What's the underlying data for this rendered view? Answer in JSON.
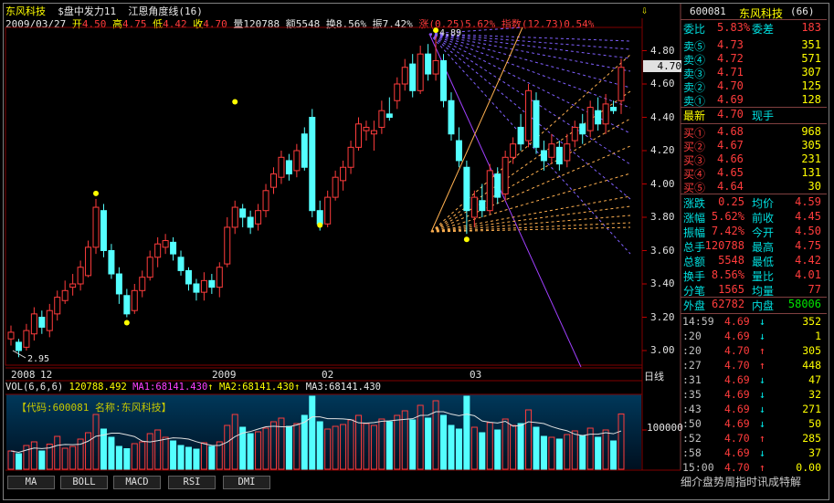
{
  "header": {
    "stock_name": "东风科技",
    "indicator": "$盘中发力11",
    "line_name": "江恩角度线(16)",
    "date": "2009/03/27",
    "open_label": "开",
    "open": "4.50",
    "high_label": "高",
    "high": "4.75",
    "low_label": "低",
    "low": "4.42",
    "close_label": "收",
    "close": "4.70",
    "vol_label": "量",
    "vol": "120788",
    "amt_label": "额",
    "amt": "5548",
    "turn_label": "换",
    "turn": "8.56%",
    "amp_label": "振",
    "amp": "7.42%",
    "chg_label": "涨",
    "chg": "(0.25)5.62%",
    "index_label": "指数",
    "index": "(12.73)0.54%",
    "flag_icon": "⇩"
  },
  "price_axis": [
    "4.80",
    "4.60",
    "4.40",
    "4.20",
    "4.00",
    "3.80",
    "3.60",
    "3.40",
    "3.20",
    "3.00"
  ],
  "current_price_tag": "4.70",
  "annotations": {
    "high_mark": "4.89",
    "low_mark": "2.95"
  },
  "time_axis": [
    "2008",
    "12",
    "2009",
    "02",
    "03"
  ],
  "period_label": "日线",
  "volume": {
    "header_name": "VOL(6,6,6)",
    "value": "120788.492",
    "ma1": "MA1:68141.430",
    "ma2": "MA2:68141.430",
    "ma3": "MA3:68141.430",
    "axis_label": "100000",
    "code_text": "【代码:600081 名称:东风科技】"
  },
  "tabs": [
    "MA",
    "BOLL",
    "MACD",
    "RSI",
    "DMI"
  ],
  "right_panel": {
    "code": "600081",
    "name": "东风科技",
    "count": "(66)",
    "weibi_label": "委比",
    "weibi": "5.83%",
    "weicha_label": "委差",
    "weicha": "183",
    "asks": [
      {
        "label": "卖⑤",
        "price": "4.73",
        "vol": "351"
      },
      {
        "label": "卖④",
        "price": "4.72",
        "vol": "571"
      },
      {
        "label": "卖③",
        "price": "4.71",
        "vol": "307"
      },
      {
        "label": "卖②",
        "price": "4.70",
        "vol": "125"
      },
      {
        "label": "卖①",
        "price": "4.69",
        "vol": "128"
      }
    ],
    "last_label": "最新",
    "last": "4.70",
    "hand_label": "现手",
    "bids": [
      {
        "label": "买①",
        "price": "4.68",
        "vol": "968"
      },
      {
        "label": "买②",
        "price": "4.67",
        "vol": "305"
      },
      {
        "label": "买③",
        "price": "4.66",
        "vol": "231"
      },
      {
        "label": "买④",
        "price": "4.65",
        "vol": "131"
      },
      {
        "label": "买⑤",
        "price": "4.64",
        "vol": "30"
      }
    ],
    "stats": [
      {
        "l1": "涨跌",
        "v1": "0.25",
        "l2": "均价",
        "v2": "4.59"
      },
      {
        "l1": "涨幅",
        "v1": "5.62%",
        "l2": "前收",
        "v2": "4.45"
      },
      {
        "l1": "振幅",
        "v1": "7.42%",
        "l2": "今开",
        "v2": "4.50"
      },
      {
        "l1": "总手",
        "v1": "120788",
        "l2": "最高",
        "v2": "4.75"
      },
      {
        "l1": "总额",
        "v1": "5548",
        "l2": "最低",
        "v2": "4.42"
      },
      {
        "l1": "换手",
        "v1": "8.56%",
        "l2": "量比",
        "v2": "4.01"
      },
      {
        "l1": "分笔",
        "v1": "1565",
        "l2": "均量",
        "v2": "77"
      }
    ],
    "outer_label": "外盘",
    "outer": "62782",
    "inner_label": "内盘",
    "inner": "58006",
    "ticks": [
      {
        "t": "14:59",
        "p": "4.69",
        "dir": "↓",
        "v": "352"
      },
      {
        "t": ":20",
        "p": "4.69",
        "dir": "↓",
        "v": "1"
      },
      {
        "t": ":20",
        "p": "4.70",
        "dir": "↑",
        "v": "305"
      },
      {
        "t": ":27",
        "p": "4.70",
        "dir": "↑",
        "v": "448"
      },
      {
        "t": ":31",
        "p": "4.69",
        "dir": "↓",
        "v": "47"
      },
      {
        "t": ":35",
        "p": "4.69",
        "dir": "↓",
        "v": "32"
      },
      {
        "t": ":43",
        "p": "4.69",
        "dir": "↓",
        "v": "271"
      },
      {
        "t": ":50",
        "p": "4.69",
        "dir": "↓",
        "v": "50"
      },
      {
        "t": ":52",
        "p": "4.70",
        "dir": "↑",
        "v": "285"
      },
      {
        "t": ":58",
        "p": "4.69",
        "dir": "↓",
        "v": "37"
      },
      {
        "t": "15:00",
        "p": "4.70",
        "dir": "↑",
        "v": "0.00"
      }
    ],
    "bottom_link": "细介盘势周指时讯成特解"
  }
}
